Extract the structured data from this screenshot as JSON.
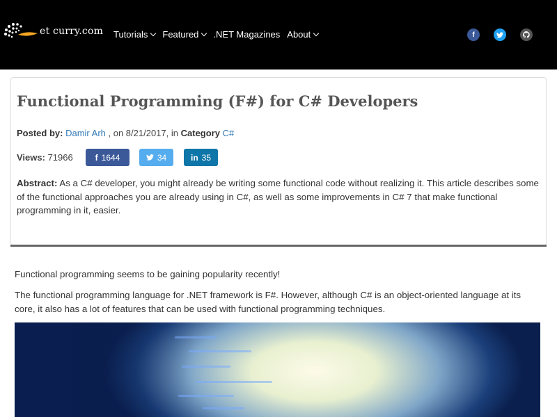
{
  "site": {
    "logo_text": "et curry.com",
    "nav": [
      {
        "label": "Tutorials",
        "has_dropdown": true
      },
      {
        "label": "Featured",
        "has_dropdown": true
      },
      {
        "label": ".NET Magazines",
        "has_dropdown": false
      },
      {
        "label": "About",
        "has_dropdown": true
      }
    ],
    "social": [
      {
        "name": "facebook-icon",
        "glyph": "f",
        "color": "#3b5998"
      },
      {
        "name": "twitter-icon",
        "glyph": "t",
        "color": "#1da1f2"
      },
      {
        "name": "github-icon",
        "glyph": "g",
        "color": "#555555"
      }
    ]
  },
  "article": {
    "title": "Functional Programming (F#) for C# Developers",
    "posted_by_label": "Posted by:",
    "author": "Damir Arh",
    "date_text": ", on 8/21/2017, in",
    "category_label": "Category",
    "category": "C#",
    "views_label": "Views:",
    "views": "71966",
    "shares": {
      "facebook": {
        "glyph": "f",
        "count": "1644"
      },
      "twitter": {
        "glyph": "t",
        "count": "34"
      },
      "linkedin": {
        "glyph": "in",
        "count": "35"
      }
    },
    "abstract_label": "Abstract:",
    "abstract_text": "As a C# developer, you might already be writing some functional code without realizing it. This article describes some of the functional approaches you are already using in C#, as well as some improvements in C# 7 that make functional programming in it, easier."
  },
  "body": {
    "paragraphs": [
      "Functional programming seems to be gaining popularity recently!",
      "The functional programming language for .NET framework is F#. However, although C# is an object-oriented language at its core, it also has a lot of features that can be used with functional programming techniques."
    ]
  },
  "colors": {
    "topbar": "#000000",
    "link": "#337ab7",
    "facebook": "#3b5998",
    "twitter": "#55acee",
    "linkedin": "#0e76a8"
  }
}
